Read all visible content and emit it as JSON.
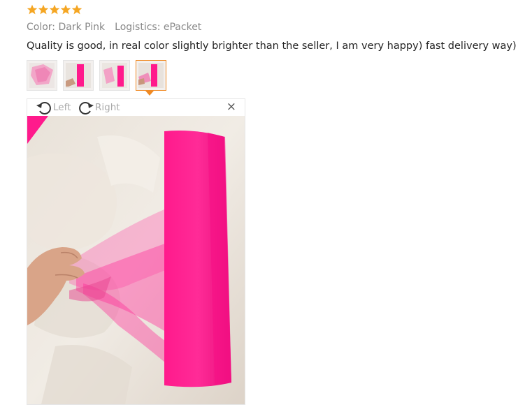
{
  "rating": {
    "stars": 5,
    "max": 5,
    "color": "#f5a623"
  },
  "meta": {
    "color_label": "Color: Dark Pink",
    "logistics_label": "Logistics: ePacket"
  },
  "review": {
    "text": "Quality is good, in real color slightly brighter than the seller, I am very happy) fast delivery way)"
  },
  "thumbnails": {
    "count": 4,
    "selected_index": 3,
    "accent": "#f08a24"
  },
  "viewer": {
    "rotate_left_label": "Left",
    "rotate_right_label": "Right",
    "close_label": "×",
    "photo_subject_color": "#ff1a8c"
  }
}
